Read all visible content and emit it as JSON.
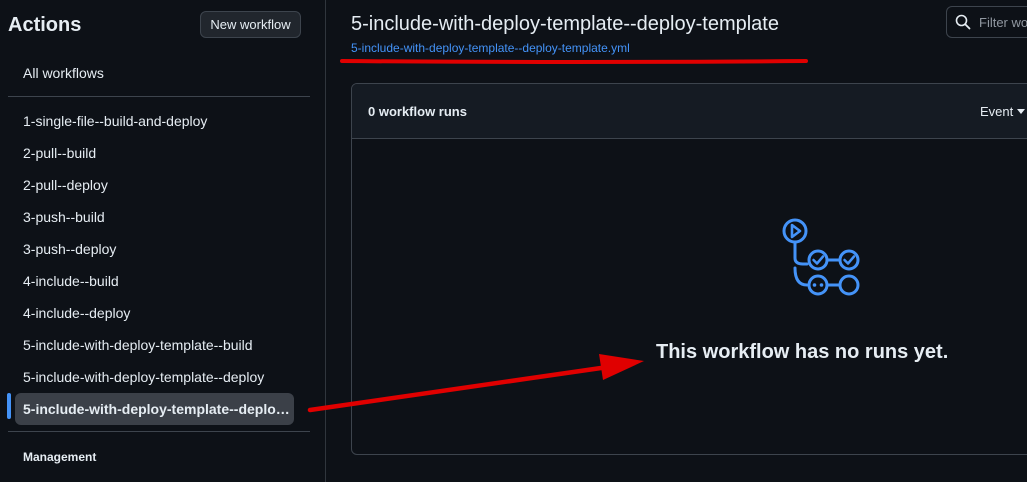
{
  "sidebar": {
    "title": "Actions",
    "new_workflow_label": "New workflow",
    "all_workflows_label": "All workflows",
    "workflows": [
      "1-single-file--build-and-deploy",
      "2-pull--build",
      "2-pull--deploy",
      "3-push--build",
      "3-push--deploy",
      "4-include--build",
      "4-include--deploy",
      "5-include-with-deploy-template--build",
      "5-include-with-deploy-template--deploy",
      "5-include-with-deploy-template--deploy-template"
    ],
    "selected_index": 9,
    "management_label": "Management"
  },
  "main": {
    "title": "5-include-with-deploy-template--deploy-template",
    "file_link": "5-include-with-deploy-template--deploy-template.yml",
    "filter_placeholder": "Filter wo",
    "runs_count_label": "0 workflow runs",
    "event_filter_label": "Event",
    "empty_message": "This workflow has no runs yet."
  },
  "colors": {
    "background": "#0d1117",
    "accent": "#4493f8",
    "annotation": "#e00000"
  }
}
